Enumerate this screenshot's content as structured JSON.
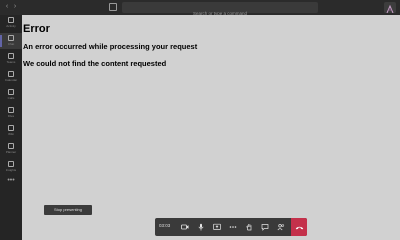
{
  "topbar": {
    "back_arrow": "‹",
    "forward_arrow": "›",
    "search_placeholder": "Search or type a command"
  },
  "rail": {
    "items": [
      {
        "label": "Activity",
        "icon": "bell-icon"
      },
      {
        "label": "Chat",
        "icon": "chat-icon"
      },
      {
        "label": "Teams",
        "icon": "teams-icon"
      },
      {
        "label": "Calendar",
        "icon": "calendar-icon"
      },
      {
        "label": "Calls",
        "icon": "phone-icon"
      },
      {
        "label": "Files",
        "icon": "file-icon"
      },
      {
        "label": "Wiki",
        "icon": "wiki-icon"
      },
      {
        "label": "Planner",
        "icon": "planner-icon"
      },
      {
        "label": "Insights",
        "icon": "insights-icon"
      }
    ],
    "more": "•••"
  },
  "content": {
    "error_title": "Error",
    "error_message": "An error occurred while processing your request",
    "error_detail": "We could not find the content requested"
  },
  "presenting": {
    "stop_label": "Stop presenting"
  },
  "call_controls": {
    "timer": "03:03"
  },
  "colors": {
    "accent": "#6264a7",
    "leave_red": "#c4314b",
    "stage_bg": "#d1d1d1"
  }
}
